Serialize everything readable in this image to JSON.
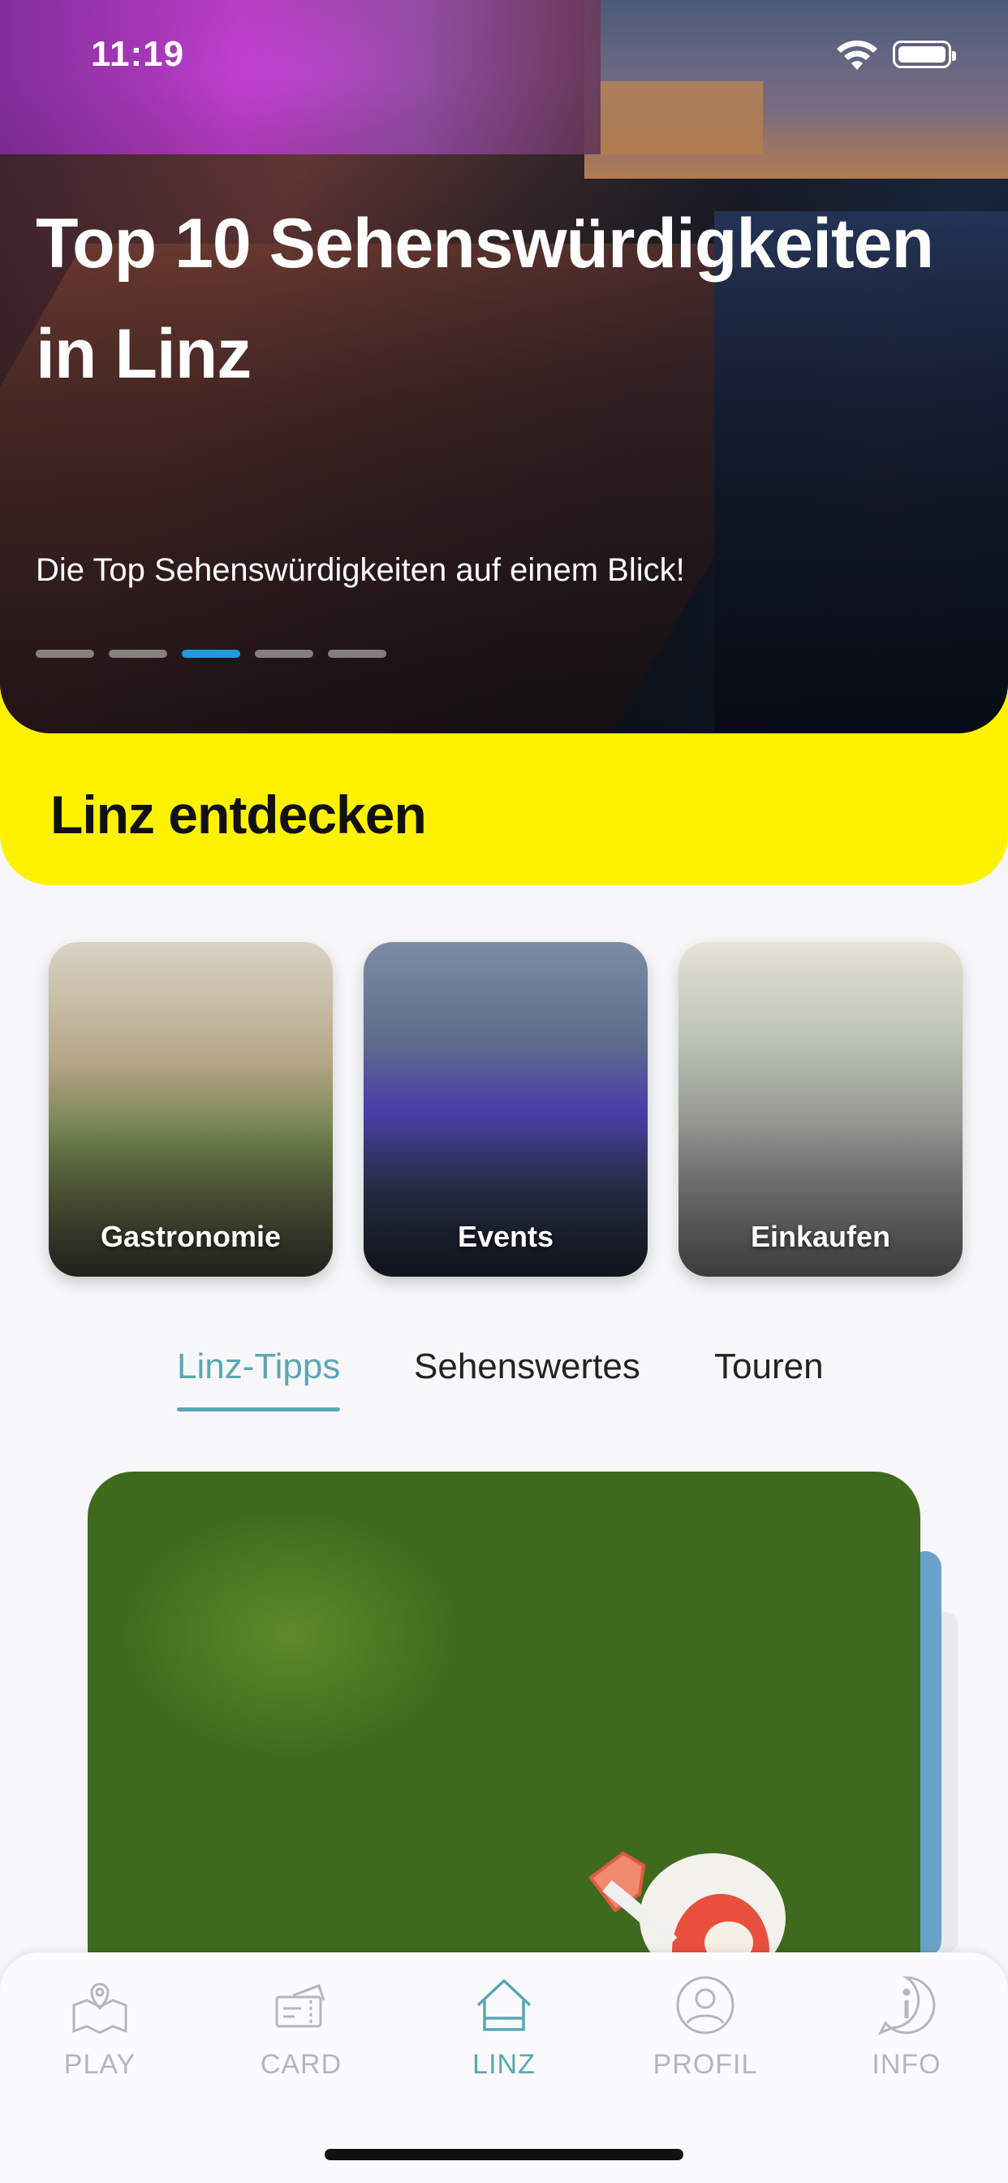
{
  "status_bar": {
    "time": "11:19"
  },
  "hero": {
    "title": "Top 10 Sehenswürdigkeiten in Linz",
    "subtitle": "Die Top Sehenswürdigkeiten auf einem Blick!",
    "page_count": 5,
    "active_page": 3
  },
  "section": {
    "title": "Linz entdecken"
  },
  "categories": [
    {
      "label": "Gastronomie"
    },
    {
      "label": "Events"
    },
    {
      "label": "Einkaufen"
    }
  ],
  "tabs": [
    {
      "label": "Linz-Tipps",
      "selected": true
    },
    {
      "label": "Sehenswertes",
      "selected": false
    },
    {
      "label": "Touren",
      "selected": false
    }
  ],
  "bottom_nav": [
    {
      "label": "PLAY",
      "icon": "map-pin-icon",
      "active": false
    },
    {
      "label": "CARD",
      "icon": "ticket-card-icon",
      "active": false
    },
    {
      "label": "LINZ",
      "icon": "house-icon",
      "active": true
    },
    {
      "label": "PROFIL",
      "icon": "user-icon",
      "active": false
    },
    {
      "label": "INFO",
      "icon": "info-icon",
      "active": false
    }
  ],
  "colors": {
    "accent": "#5aa6b7",
    "highlight_yellow": "#fff200",
    "active_dot": "#1e9be0",
    "inactive_nav": "#b5b5bd"
  }
}
